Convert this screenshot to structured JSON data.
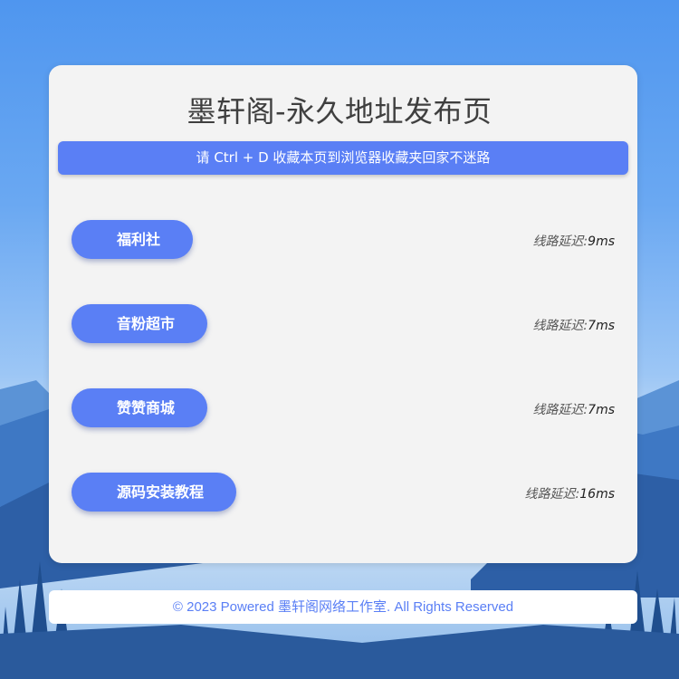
{
  "page": {
    "title": "墨轩阁-永久地址发布页",
    "notice": "请 Ctrl + D 收藏本页到浏览器收藏夹回家不迷路",
    "latency_label": "线路延迟:"
  },
  "links": [
    {
      "label": "福利社",
      "latency": "9ms"
    },
    {
      "label": "音粉超市",
      "latency": "7ms"
    },
    {
      "label": "赞赞商城",
      "latency": "7ms"
    },
    {
      "label": "源码安装教程",
      "latency": "16ms"
    }
  ],
  "footer": {
    "text": "© 2023 Powered 墨轩阁网络工作室. All Rights Reserved"
  },
  "colors": {
    "accent": "#5a7ff5",
    "card": "#f3f3f3",
    "sky_top": "#4f96ef",
    "mountain_dark": "#2d5fa6"
  },
  "background": {
    "scene": "mountain-lake-forest-illustration"
  }
}
